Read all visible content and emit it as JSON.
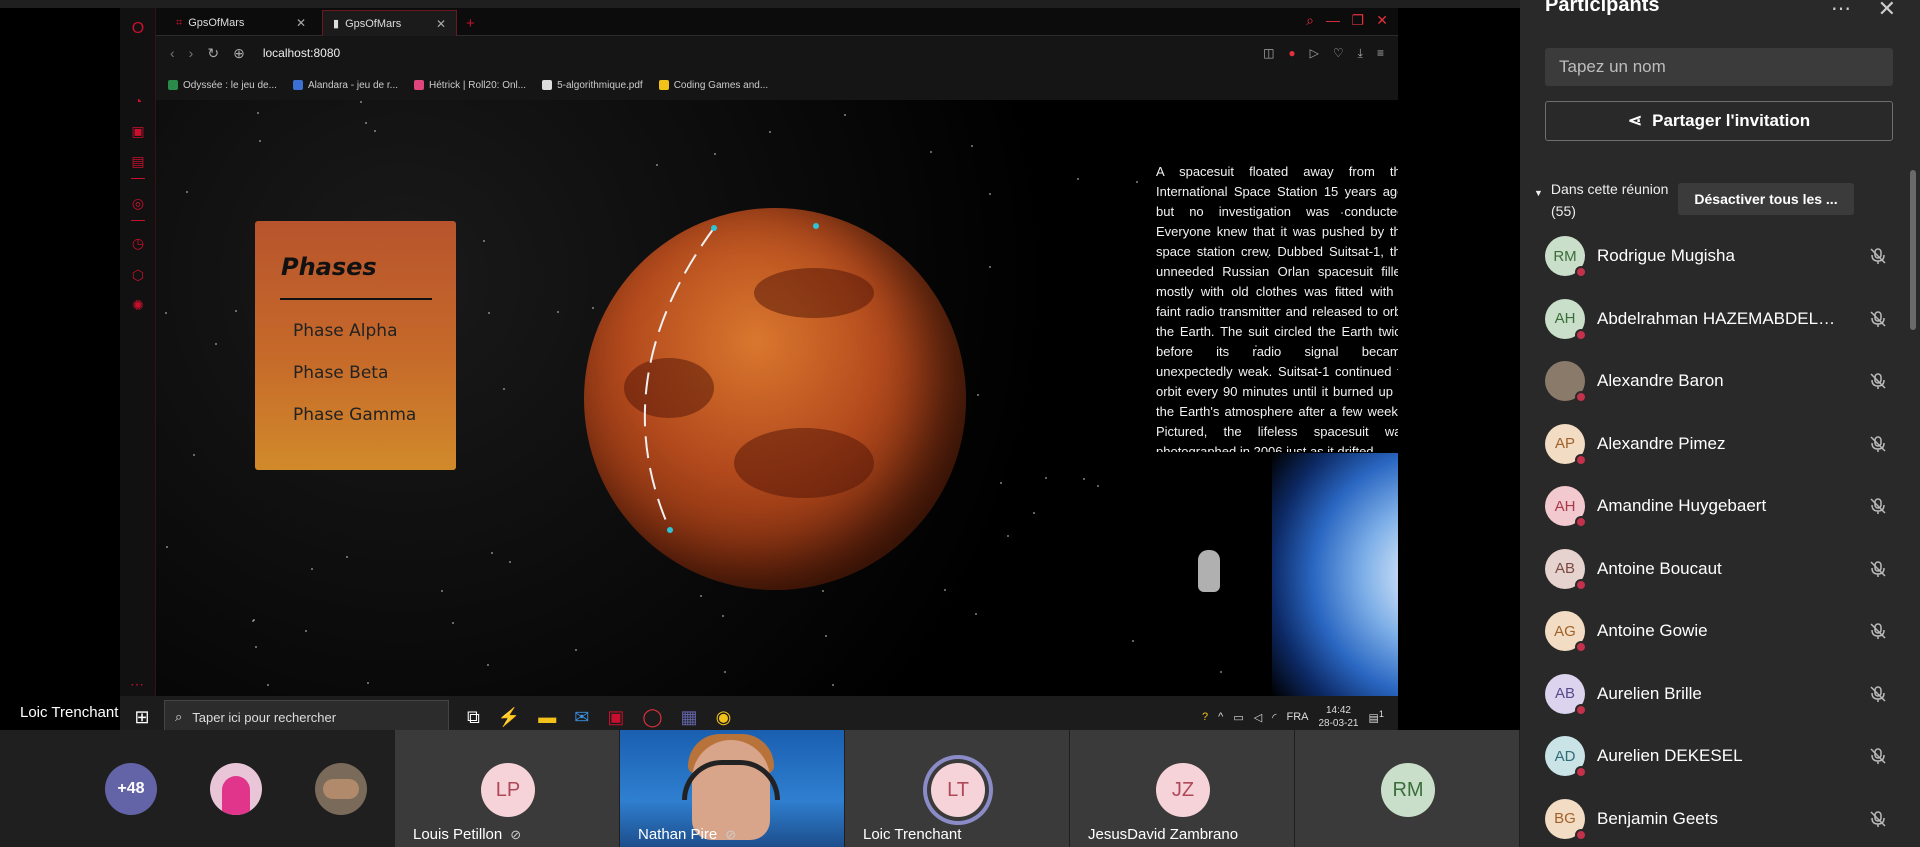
{
  "presenter": {
    "name": "Loic Trenchant"
  },
  "browser": {
    "tabs": [
      {
        "label": "GpsOfMars"
      },
      {
        "label": "GpsOfMars"
      }
    ],
    "url": "localhost:8080",
    "bookmarks": [
      {
        "label": "Odyssée : le jeu de...",
        "color": "#2a8a4a"
      },
      {
        "label": "Alandara - jeu de r...",
        "color": "#3b6fd4"
      },
      {
        "label": "Hétrick | Roll20: Onl...",
        "color": "#e0457b"
      },
      {
        "label": "5-algorithmique.pdf",
        "color": "#dddddd"
      },
      {
        "label": "Coding Games and...",
        "color": "#f2c21b"
      }
    ]
  },
  "page": {
    "phases": {
      "title": "Phases",
      "items": [
        "Phase Alpha",
        "Phase Beta",
        "Phase Gamma"
      ]
    },
    "article": "A spacesuit floated away from the International Space Station 15 years ago, but no investigation was conducted. Everyone knew that it was pushed by the space station crew. Dubbed Suitsat-1, the unneeded Russian Orlan spacesuit filled mostly with old clothes was fitted with a faint radio transmitter and released to orbit the Earth. The suit circled the Earth twice before its radio signal became unexpectedly weak. Suitsat-1 continued to orbit every 90 minutes until it burned up in the Earth's atmosphere after a few weeks. Pictured, the lifeless spacesuit was photographed in 2006 just as it drifted"
  },
  "taskbar": {
    "search_placeholder": "Taper ici pour rechercher",
    "language": "FRA",
    "time": "14:42",
    "date": "28-03-21",
    "notifications": "1"
  },
  "panel": {
    "title": "Participants",
    "search_placeholder": "Tapez un nom",
    "share_label": "Partager l'invitation",
    "section_label": "Dans cette réunion",
    "section_count": "(55)",
    "mute_all_label": "Désactiver tous les ...",
    "participants": [
      {
        "initials": "RM",
        "name": "Rodrigue Mugisha",
        "bg": "#c9dfc9",
        "fg": "#3b6e3b"
      },
      {
        "initials": "AH",
        "name": "Abdelrahman HAZEMABDELF...",
        "bg": "#c9dfc9",
        "fg": "#3b6e3b"
      },
      {
        "initials": "",
        "name": "Alexandre Baron",
        "bg": "#8a7a6a",
        "fg": "#fff"
      },
      {
        "initials": "AP",
        "name": "Alexandre Pimez",
        "bg": "#f2dcc4",
        "fg": "#a0622a"
      },
      {
        "initials": "AH",
        "name": "Amandine Huygebaert",
        "bg": "#f2c9cf",
        "fg": "#a83a4a"
      },
      {
        "initials": "AB",
        "name": "Antoine Boucaut",
        "bg": "#e6d3cf",
        "fg": "#7a4a40"
      },
      {
        "initials": "AG",
        "name": "Antoine Gowie",
        "bg": "#f2dcc4",
        "fg": "#a0622a"
      },
      {
        "initials": "AB",
        "name": "Aurelien Brille",
        "bg": "#dcd3ee",
        "fg": "#5a4a8a"
      },
      {
        "initials": "AD",
        "name": "Aurelien DEKESEL",
        "bg": "#c9e3e6",
        "fg": "#2f6e78"
      },
      {
        "initials": "BG",
        "name": "Benjamin Geets",
        "bg": "#f2dcc4",
        "fg": "#a0622a"
      }
    ]
  },
  "strip": {
    "overflow_count": "+48",
    "tiles": [
      {
        "initials": "LP",
        "name": "Louis Petillon",
        "muted": true,
        "bg": "#f6d3d8",
        "fg": "#b0485a"
      },
      {
        "initials": "",
        "name": "Nathan Pire",
        "muted": true,
        "video": true
      },
      {
        "initials": "LT",
        "name": "Loic Trenchant",
        "muted": false,
        "bg": "#f6d3d8",
        "fg": "#b0485a",
        "speaking": true
      },
      {
        "initials": "JZ",
        "name": "JesusDavid Zambrano",
        "muted": false,
        "bg": "#f6d3d8",
        "fg": "#b0485a"
      },
      {
        "initials": "RM",
        "name": "",
        "muted": false,
        "bg": "#c9dfc9",
        "fg": "#3b6e3b"
      }
    ]
  }
}
